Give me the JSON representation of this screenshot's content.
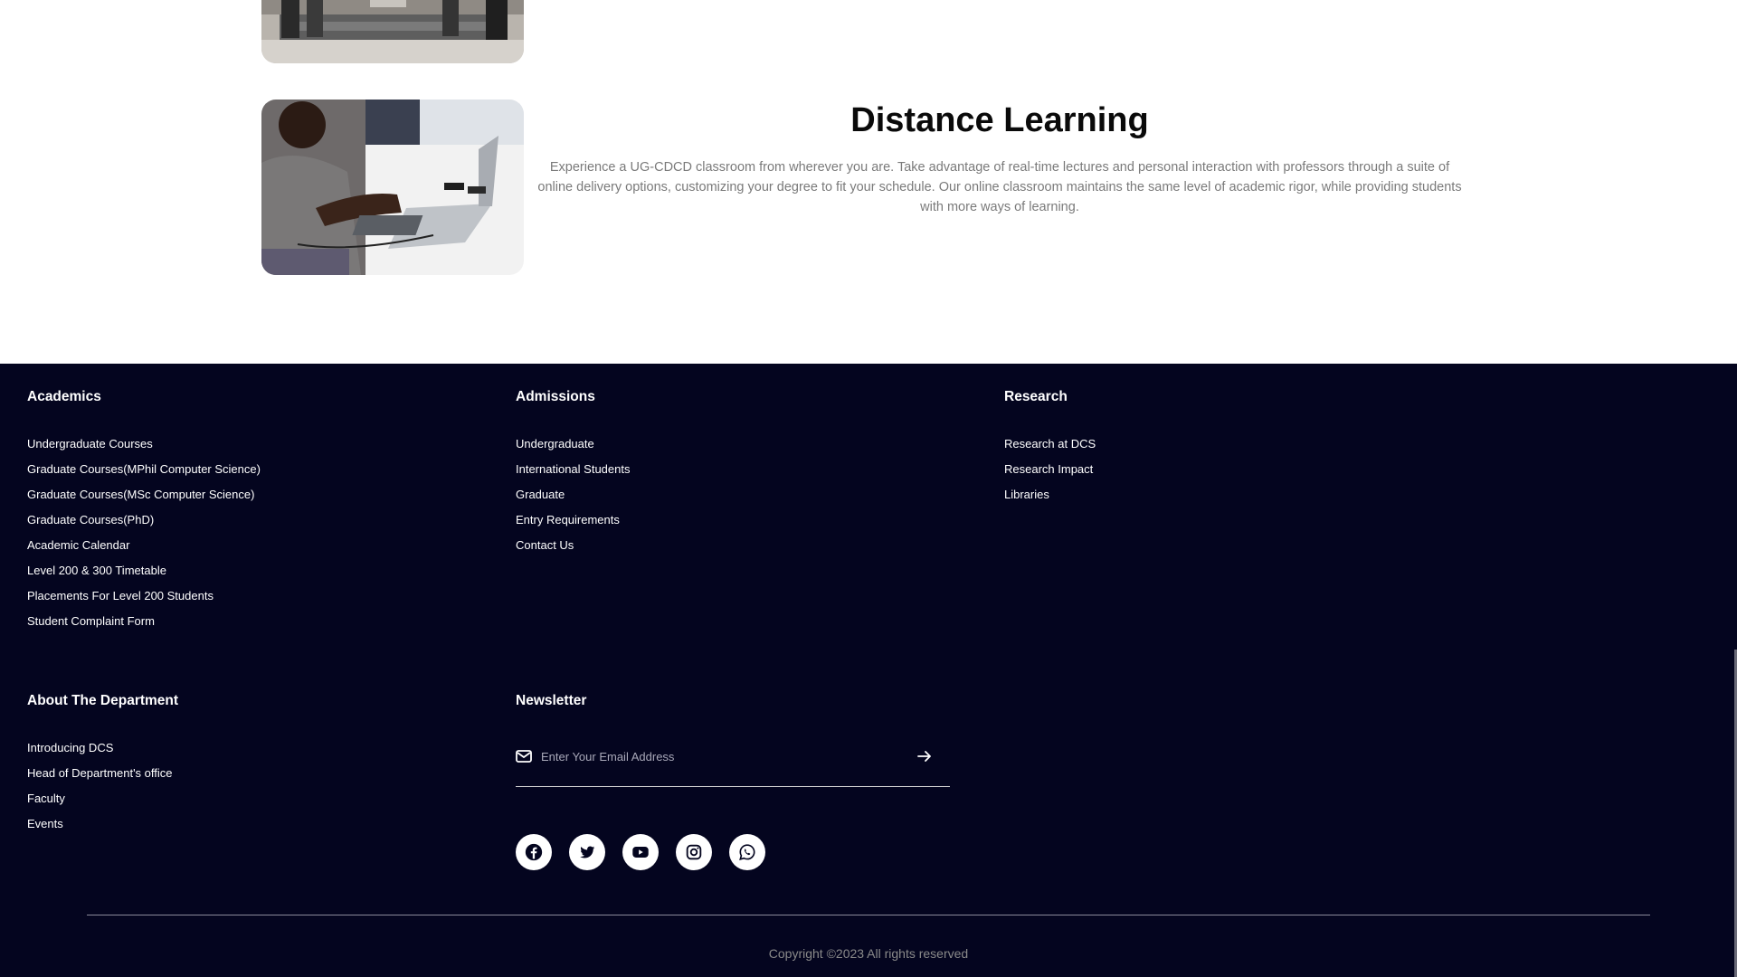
{
  "distance_learning": {
    "title": "Distance Learning",
    "text": "Experience a UG-CDCD classroom from wherever you are. Take advantage of real-time lectures and personal interaction with professors through a suite of online delivery options, customizing your degree to fit your schedule. Our online classroom maintains the same level of academic rigor, while providing students with more ways of learning."
  },
  "footer": {
    "academics": {
      "title": "Academics",
      "links": [
        "Undergraduate Courses",
        "Graduate Courses(MPhil Computer Science)",
        "Graduate Courses(MSc Computer Science)",
        "Graduate Courses(PhD)",
        "Academic Calendar",
        "Level 200 & 300 Timetable",
        "Placements For Level 200 Students",
        "Student Complaint Form"
      ]
    },
    "admissions": {
      "title": "Admissions",
      "links": [
        "Undergraduate",
        "International Students",
        "Graduate",
        "Entry Requirements",
        "Contact Us"
      ]
    },
    "research": {
      "title": "Research",
      "links": [
        "Research at DCS",
        "Research Impact",
        "Libraries"
      ]
    },
    "about": {
      "title": "About The Department",
      "links": [
        "Introducing DCS",
        "Head of Department's office",
        "Faculty",
        "Events"
      ]
    },
    "newsletter": {
      "title": "Newsletter",
      "placeholder": "Enter Your Email Address",
      "value": ""
    },
    "socials": [
      "facebook-icon",
      "twitter-icon",
      "youtube-icon",
      "instagram-icon",
      "whatsapp-icon"
    ],
    "copyright": "Copyright ©2023 All rights reserved"
  },
  "colors": {
    "footer_bg": "#04051f",
    "body_text_gray": "#7a7a7a",
    "title_black": "#0a0a0a"
  }
}
